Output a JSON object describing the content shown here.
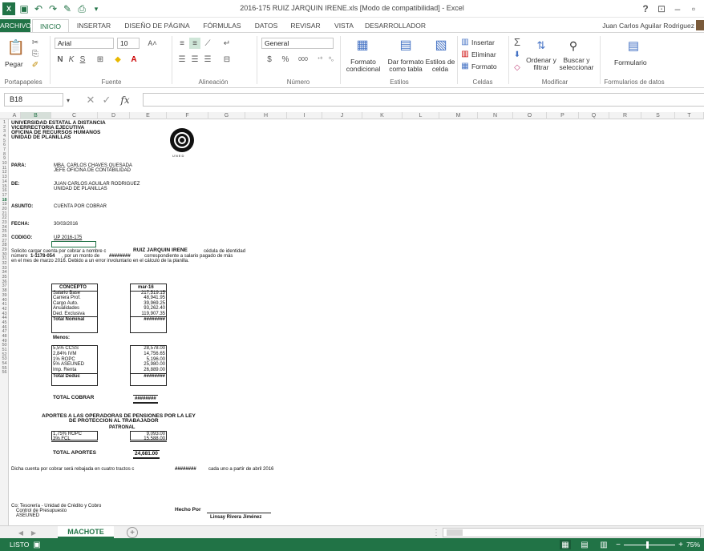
{
  "titlebar": {
    "title": "2016-175 RUIZ JARQUIN IRENE.xls  [Modo de compatibilidad] - Excel",
    "help": "?",
    "min": "–",
    "max": "▫"
  },
  "tabs": [
    "ARCHIVO",
    "INICIO",
    "INSERTAR",
    "DISEÑO DE PÁGINA",
    "FÓRMULAS",
    "DATOS",
    "REVISAR",
    "VISTA",
    "DESARROLLADOR"
  ],
  "user": "Juan Carlos Aguilar Rodriguez",
  "ribbon": {
    "paste": "Pegar",
    "clipboard": "Portapapeles",
    "font_name": "Arial",
    "font_size": "10",
    "font_group": "Fuente",
    "align_group": "Alineación",
    "number_format": "General",
    "number_group": "Número",
    "cond_format": "Formato condicional",
    "table_format": "Dar formato como tabla",
    "cell_styles": "Estilos de celda",
    "styles_group": "Estilos",
    "insert": "Insertar",
    "delete": "Eliminar",
    "format": "Formato",
    "cells_group": "Celdas",
    "sort": "Ordenar y filtrar",
    "find": "Buscar y seleccionar",
    "modify_group": "Modificar",
    "form": "Formulario",
    "form_group": "Formularios de datos"
  },
  "namebox": "B18",
  "columns": [
    "A",
    "B",
    "C",
    "D",
    "E",
    "F",
    "G",
    "H",
    "I",
    "J",
    "K",
    "L",
    "M",
    "N",
    "O",
    "P",
    "Q",
    "R",
    "S",
    "T"
  ],
  "header": {
    "l1": "UNIVERSIDAD ESTATAL A DISTANCIA",
    "l2": "VICERRECTORIA EJECUTIVA",
    "l3": "OFICINA DE RECURSOS HUMANOS",
    "l4": "UNIDAD DE PLANILLAS",
    "logo_text": "UNED"
  },
  "memo": {
    "para_label": "PARA:",
    "para1": "MBA. CARLOS CHAVES QUESADA",
    "para2": "JEFE OFICINA DE CONTABILIDAD",
    "de_label": "DE:",
    "de1": "JUAN CARLOS AGUILAR RODRIGUEZ",
    "de2": "UNIDAD DE PLANILLAS",
    "asunto_label": "ASUNTO:",
    "asunto": "CUENTA POR COBRAR",
    "fecha_label": "FECHA:",
    "fecha": "30/03/2016",
    "codigo_label": "CODIGO:",
    "codigo": "UP 2016-175",
    "p1a": "Solicito cargar cuenta por cobrar a nombre c",
    "p1name": "RUIZ JARQUIN IRENE",
    "p1b": "cédula de identidad",
    "p2a": "número",
    "p2id": "1-1178-054",
    "p2b": ", por un monto de",
    "p2amt": "########",
    "p2c": "correspondiente a salario pagado de más",
    "p3": "en el mes de marzo 2016. Debido a un error involuntario en el cálculo de la planilla."
  },
  "table1": {
    "h1": "CONCEPTO",
    "h2": "mar-16",
    "rows": [
      [
        "Salario Base",
        "217,519.15"
      ],
      [
        "Carrera Prof.",
        "48,941.95"
      ],
      [
        "Cargo Auto.",
        "39,969.25"
      ],
      [
        "Anualidades",
        "93,262.40"
      ],
      [
        "Ded. Exclusiva",
        "119,907.35"
      ]
    ],
    "total_label": "Total Nominal",
    "total_value": "########"
  },
  "table2": {
    "title": "Menos:",
    "rows": [
      [
        "5,5% CCSS",
        "28,578.00"
      ],
      [
        "2,84% IVM",
        "14,756.65"
      ],
      [
        "1% ROPC",
        "5,196.00"
      ],
      [
        "5% ASEUNED",
        "25,980.00"
      ],
      [
        "Imp. Renta",
        "26,889.00"
      ]
    ],
    "total_label": "Total Deduc",
    "total_value": "########"
  },
  "total_cobrar_label": "TOTAL COBRAR",
  "total_cobrar_value": "########",
  "aportes": {
    "t1": "APORTES A LAS OPERADORAS DE PENSIONES  POR LA LEY",
    "t2": "DE PROTECCION AL TRABAJADOR",
    "t3": "PATRONAL",
    "rows": [
      [
        "1,75% ROPC",
        "9,093.00"
      ],
      [
        "3% FCL",
        "15,588.00"
      ]
    ],
    "total_label": "TOTAL APORTES",
    "total_value": "24,681.00"
  },
  "footer": {
    "l50a": "Dicha cuenta por cobrar será rebajada en cuatro tractos c",
    "l50amt": "########",
    "l50b": "cada uno a partir de abril 2016",
    "cc1": "Co: Tesorería - Unidad de Crédito y Cobro",
    "cc2": "Control de Presupuesto",
    "cc3": "ASEUNED",
    "hecho": "Hecho Por",
    "firma": "Linsay Rivera Jiménez"
  },
  "sheet_tab": "MACHOTE",
  "status": {
    "mode": "LISTO",
    "zoom": "75%"
  }
}
